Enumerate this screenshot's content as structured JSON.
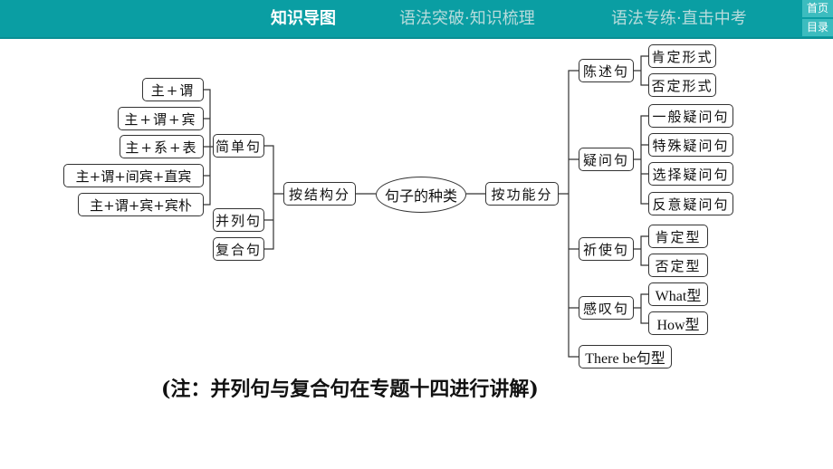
{
  "header": {
    "tabs": [
      {
        "label": "知识导图",
        "active": true
      },
      {
        "label": "语法突破·知识梳理",
        "active": false
      },
      {
        "label": "语法专练·直击中考",
        "active": false
      }
    ],
    "nav_buttons": {
      "home": "首页",
      "contents": "目录"
    },
    "colors": {
      "bar": "#0a9ea3",
      "active_text": "#ffffff",
      "inactive_text": "#b8dcdc"
    }
  },
  "diagram": {
    "root": "句子的种类",
    "by_structure": {
      "label": "按结构分",
      "simple": {
        "label": "简单句",
        "patterns": [
          "主+谓",
          "主+谓+宾",
          "主+系+表",
          "主+谓+间宾+直宾",
          "主+谓+宾+宾朴"
        ]
      },
      "compound": "并列句",
      "complex": "复合句"
    },
    "by_function": {
      "label": "按功能分",
      "declarative": {
        "label": "陈述句",
        "children": [
          "肯定形式",
          "否定形式"
        ]
      },
      "interrogative": {
        "label": "疑问句",
        "children": [
          "一般疑问句",
          "特殊疑问句",
          "选择疑问句",
          "反意疑问句"
        ]
      },
      "imperative": {
        "label": "祈使句",
        "children": [
          "肯定型",
          "否定型"
        ]
      },
      "exclamatory": {
        "label": "感叹句",
        "children": [
          "What型",
          "How型"
        ]
      },
      "there_be": {
        "label": "There be句型"
      }
    }
  },
  "note": "(注：并列句与复合句在专题十四进行讲解)"
}
